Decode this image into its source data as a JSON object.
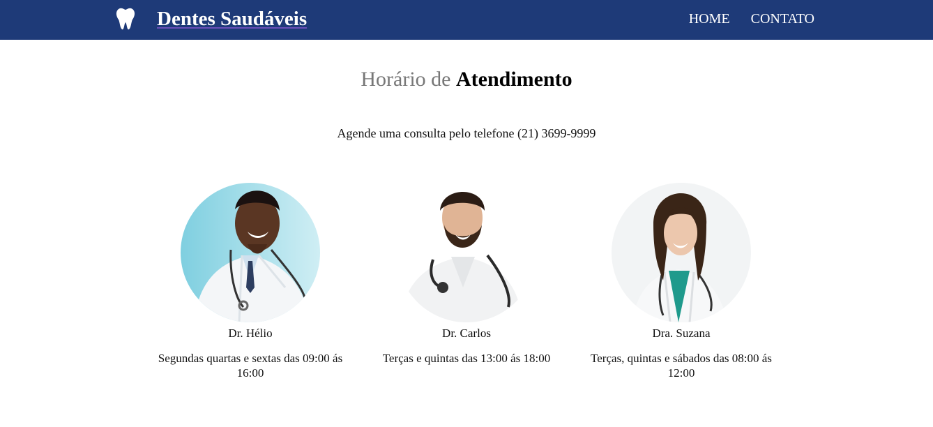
{
  "header": {
    "logo_icon": "tooth-icon",
    "brand": "Dentes Saudáveis",
    "nav": [
      {
        "label": "HOME"
      },
      {
        "label": "CONTATO"
      }
    ]
  },
  "main": {
    "title_light": "Horário de",
    "title_bold": "Atendimento",
    "subtitle": "Agende uma consulta pelo telefone (21) 3699-9999"
  },
  "doctors": [
    {
      "name": "Dr. Hélio",
      "hours": "Segundas quartas e sextas das 09:00 ás 16:00"
    },
    {
      "name": "Dr. Carlos",
      "hours": "Terças e quintas das 13:00 ás 18:00"
    },
    {
      "name": "Dra. Suzana",
      "hours": "Terças, quintas e sábados das 08:00 ás 12:00"
    }
  ],
  "colors": {
    "header_bg": "#1e3a78",
    "title_light": "#777777"
  }
}
